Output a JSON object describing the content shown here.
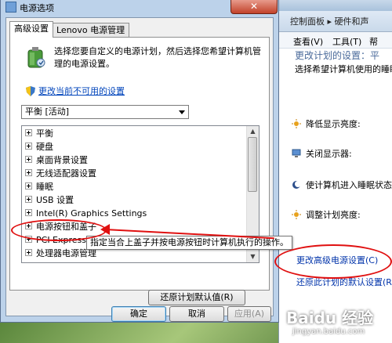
{
  "dialog": {
    "title": "电源选项",
    "close_label": "✕",
    "tabs": [
      {
        "label": "高级设置",
        "active": true
      },
      {
        "label": "Lenovo 电源管理",
        "active": false
      }
    ],
    "description": "选择您要自定义的电源计划，然后选择您希望计算机管理的电源设置。",
    "change_unavailable_link": "更改当前不可用的设置",
    "plan_select_value": "平衡 [活动]",
    "tree_items": [
      "平衡",
      "硬盘",
      "桌面背景设置",
      "无线适配器设置",
      "睡眠",
      "USB 设置",
      "Intel(R) Graphics Settings",
      "电源按钮和盖子",
      "PCI Express",
      "处理器电源管理"
    ],
    "tooltip": "指定当合上盖子并按电源按钮时计算机执行的操作。",
    "restore_defaults": "还原计划默认值(R)",
    "ok": "确定",
    "cancel": "取消",
    "apply": "应用(A)"
  },
  "control_panel": {
    "breadcrumb": "控制面板 ▸ 硬件和声",
    "menu": [
      "查看(V)",
      "工具(T)",
      "帮"
    ],
    "partial_heading": "更改计划的设置：平",
    "partial_sub": "选择希望计算机使用的睡眠",
    "settings": [
      {
        "label": "降低显示亮度:",
        "icon": "sun-icon"
      },
      {
        "label": "关闭显示器:",
        "icon": "monitor-icon"
      },
      {
        "label": "使计算机进入睡眠状态",
        "icon": "moon-icon"
      },
      {
        "label": "调整计划亮度:",
        "icon": "sun-icon"
      }
    ],
    "link_advanced": "更改高级电源设置(C)",
    "link_restore": "还原此计划的默认设置(R)"
  },
  "watermark": {
    "logo": "Baidu 经验",
    "url": "jingyan.baidu.com"
  },
  "colors": {
    "annotation": "#e01010",
    "link": "#0044bb"
  }
}
